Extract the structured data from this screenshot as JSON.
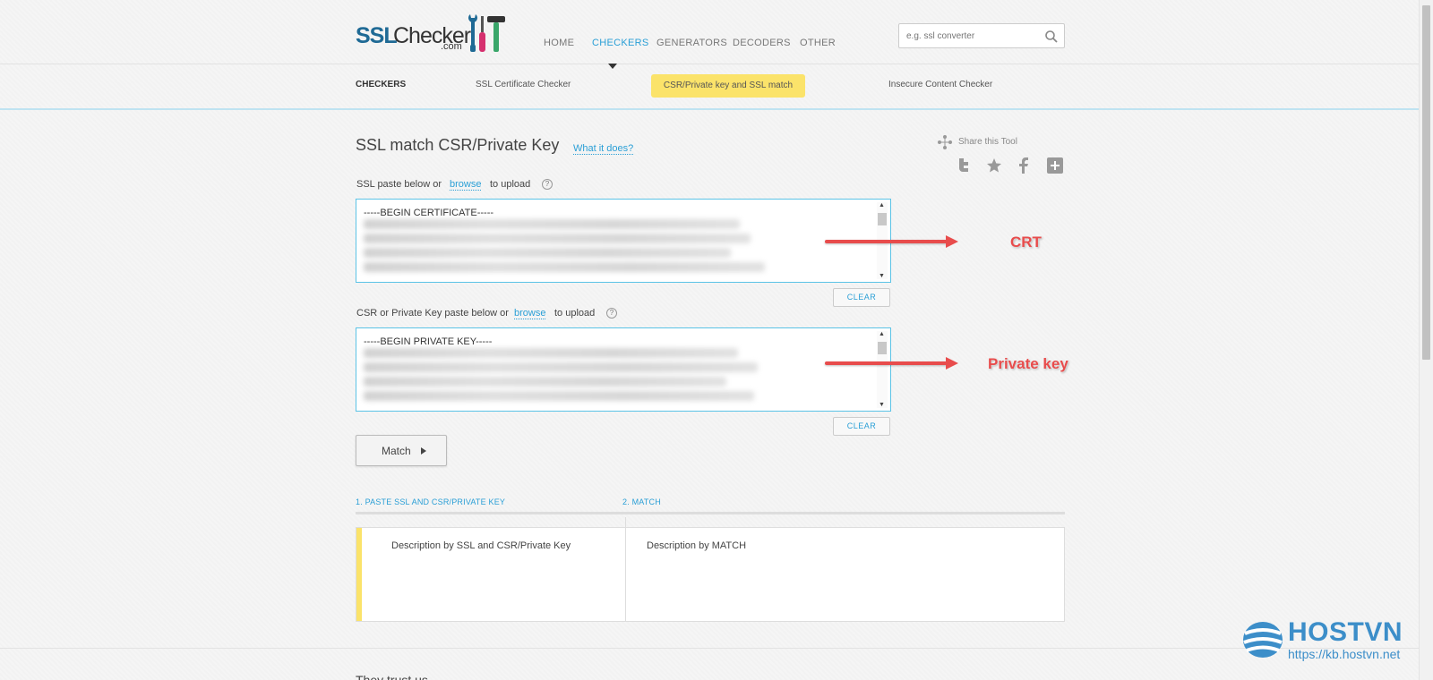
{
  "brand": {
    "logo_main": "SSL",
    "logo_rest": "Checker",
    "logo_tld": ".com"
  },
  "nav": {
    "items": [
      "HOME",
      "CHECKERS",
      "GENERATORS",
      "DECODERS",
      "OTHER"
    ],
    "active": "CHECKERS"
  },
  "search": {
    "placeholder": "e.g. ssl converter"
  },
  "subnav": {
    "title": "CHECKERS",
    "items": [
      "SSL Certificate Checker",
      "CSR/Private key and SSL match",
      "Insecure Content Checker"
    ],
    "active": "CSR/Private key and SSL match"
  },
  "main": {
    "title": "SSL match CSR/Private Key",
    "what_link": "What it does?",
    "share_label": "Share this Tool",
    "ssl_field": {
      "label_before": "SSL paste below or",
      "browse": "browse",
      "label_after": "to upload",
      "help": "?",
      "value_first_line": "-----BEGIN CERTIFICATE-----",
      "clear": "CLEAR"
    },
    "key_field": {
      "label_before": "CSR or Private Key paste below or",
      "browse": "browse",
      "label_after": "to upload",
      "help": "?",
      "value_first_line": "-----BEGIN PRIVATE KEY-----",
      "clear": "CLEAR"
    },
    "match_button": "Match"
  },
  "annotations": {
    "crt": "CRT",
    "private_key": "Private key",
    "color": "#e84c4c"
  },
  "steps": {
    "step1": "1. PASTE SSL AND CSR/PRIVATE KEY",
    "step2": "2. MATCH",
    "desc1": "Description by SSL and CSR/Private Key",
    "desc2": "Description by MATCH"
  },
  "footer": {
    "trust_heading": "They trust us"
  },
  "watermark": {
    "name": "HOSTVN",
    "url": "https://kb.hostvn.net"
  },
  "colors": {
    "accent": "#2a9fd6",
    "highlight": "#fbe36a",
    "brand_blue": "#1f6a95"
  }
}
